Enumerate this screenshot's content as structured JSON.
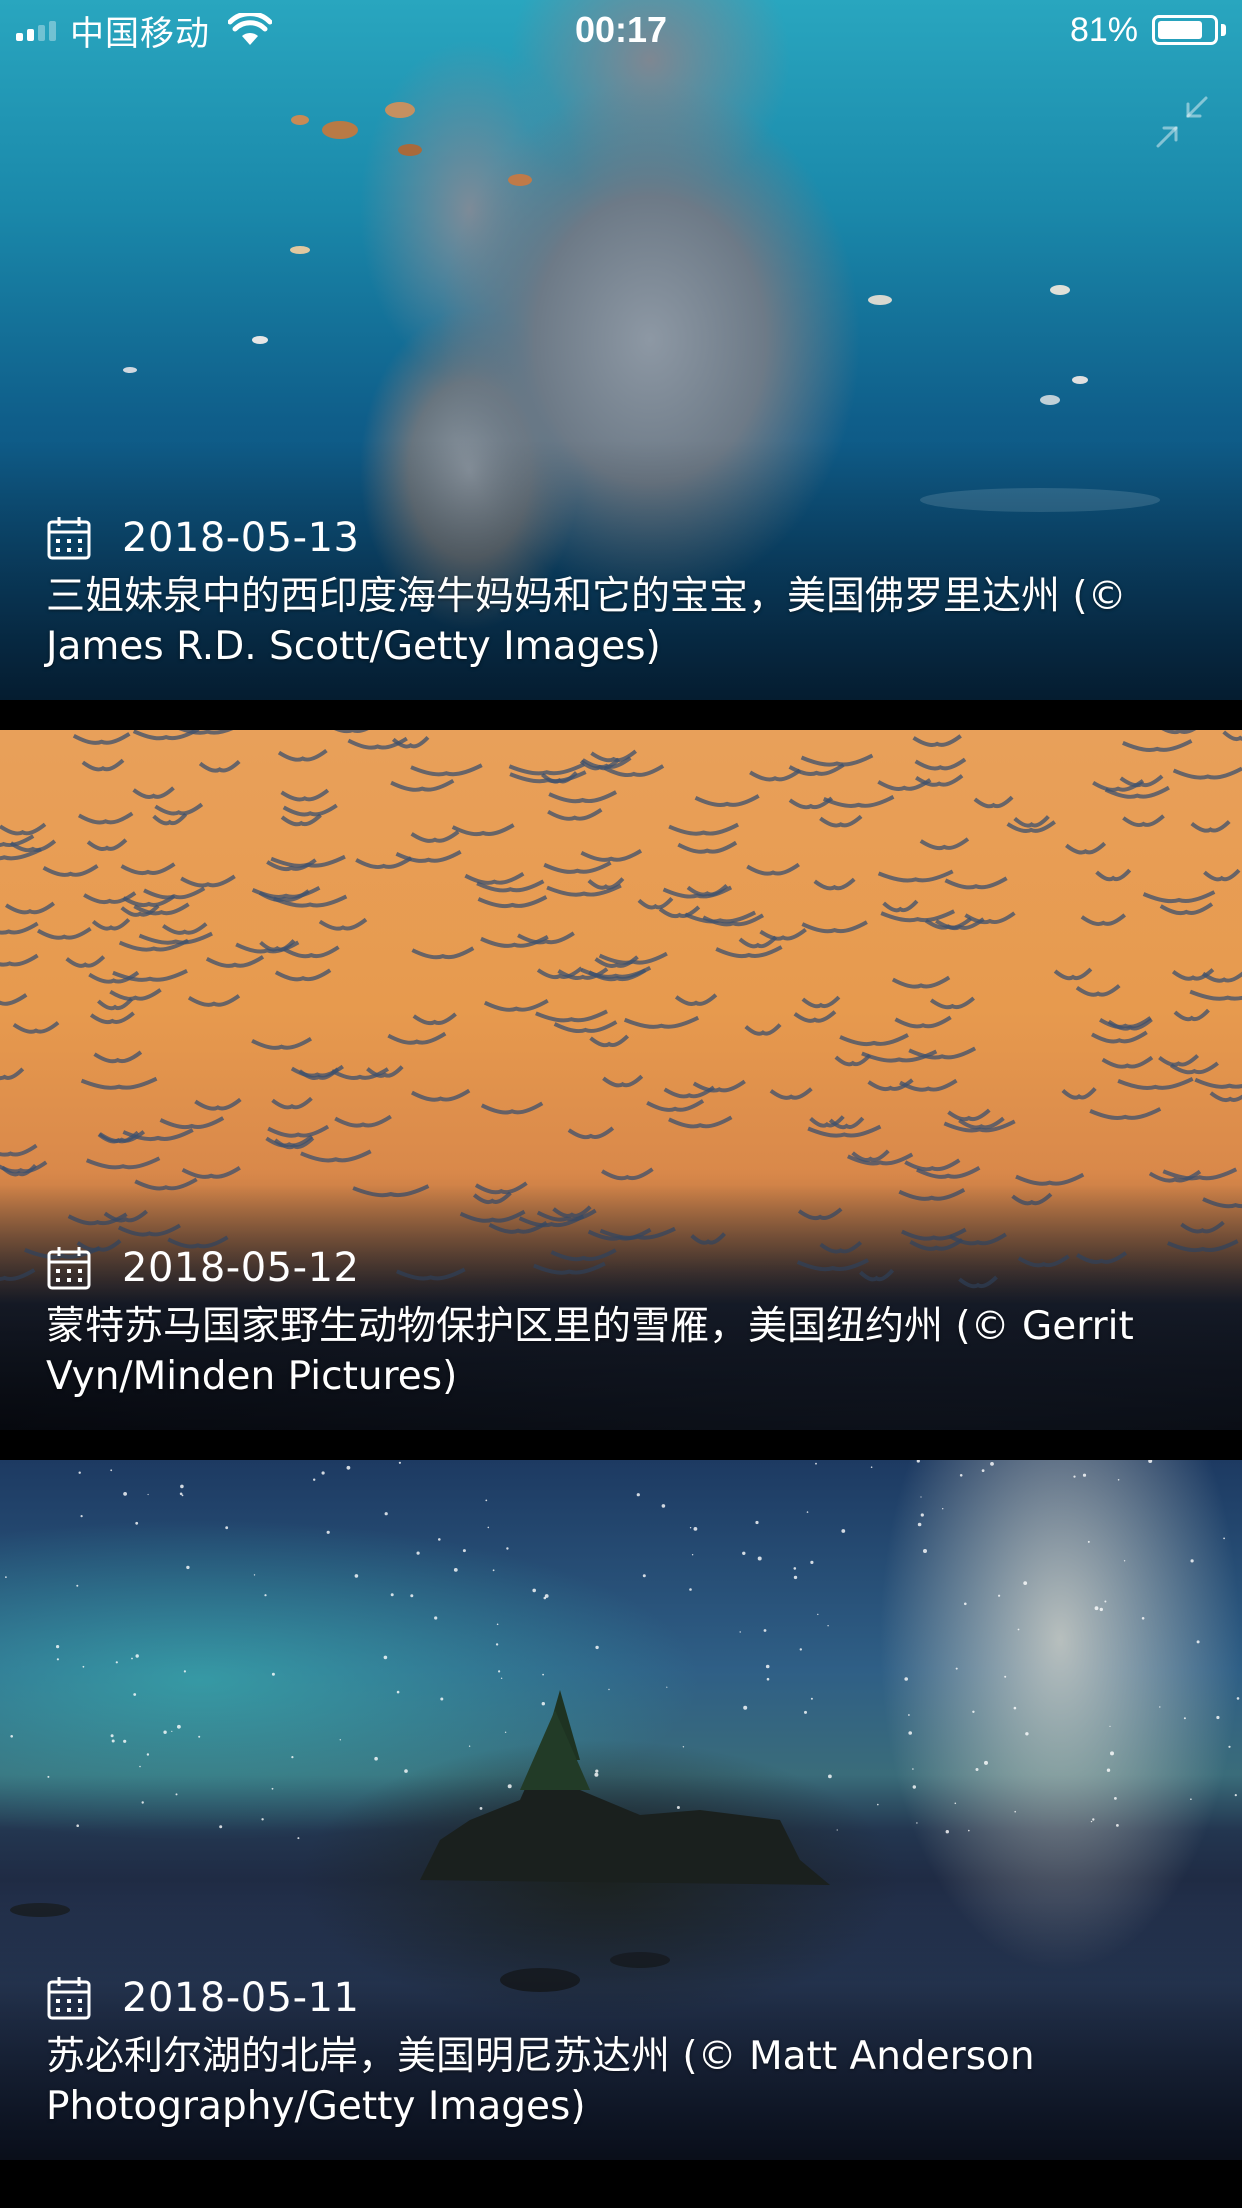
{
  "status_bar": {
    "carrier": "中国移动",
    "time": "00:17",
    "battery_percent_label": "81%",
    "battery_level": 0.81,
    "icons": [
      "signal-icon",
      "wifi-icon",
      "battery-icon"
    ]
  },
  "top_icon": "collapse-icon",
  "cards": [
    {
      "date": "2018-05-13",
      "caption": "三姐妹泉中的西印度海牛妈妈和它的宝宝，美国佛罗里达州 (© James R.D. Scott/Getty Images)"
    },
    {
      "date": "2018-05-12",
      "caption": "蒙特苏马国家野生动物保护区里的雪雁，美国纽约州 (© Gerrit Vyn/Minden Pictures)"
    },
    {
      "date": "2018-05-11",
      "caption": "苏必利尔湖的北岸，美国明尼苏达州 (© Matt Anderson Photography/Getty Images)"
    }
  ]
}
